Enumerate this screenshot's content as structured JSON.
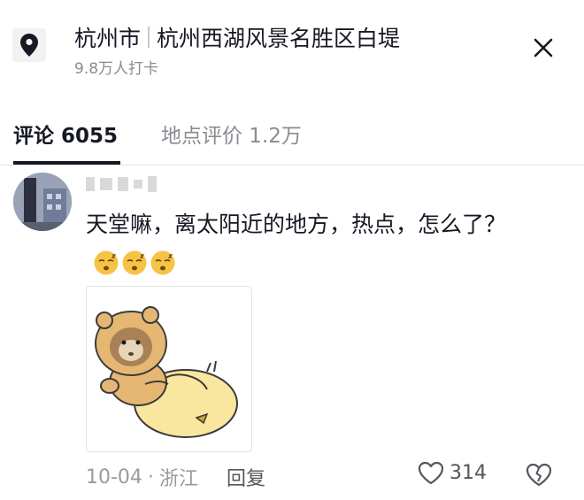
{
  "header": {
    "city": "杭州市",
    "place": "杭州西湖风景名胜区白堤",
    "checkins": "9.8万人打卡"
  },
  "tabs": {
    "comments_label": "评论 6055",
    "reviews_label": "地点评价 1.2万"
  },
  "comment": {
    "text": "天堂嘛，离太阳近的地方，热点，怎么了？",
    "date": "10-04",
    "separator": "·",
    "region": "浙江",
    "reply_label": "回复",
    "like_count": "314"
  },
  "icons": {
    "location": "map-pin-icon",
    "close": "close-icon",
    "like": "heart-outline-icon",
    "dislike": "broken-heart-icon"
  }
}
